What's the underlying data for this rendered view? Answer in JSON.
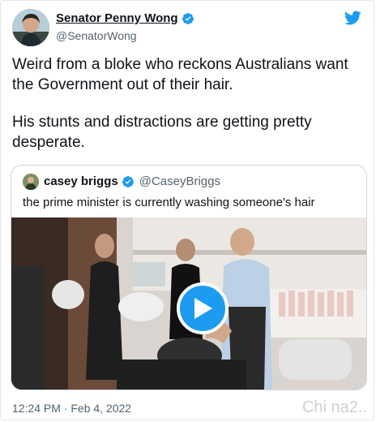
{
  "author": {
    "name": "Senator Penny Wong",
    "handle": "@SenatorWong"
  },
  "tweet": {
    "paragraphs": [
      "Weird from a bloke who reckons Australians want the Government out of their hair.",
      "His stunts and distractions are getting pretty desperate."
    ]
  },
  "quoted": {
    "name": "casey briggs",
    "handle": "@CaseyBriggs",
    "text": "the prime minister is currently washing someone's hair"
  },
  "media": {
    "type": "video",
    "play_icon": "play-icon"
  },
  "footer": {
    "timestamp": "12:24 PM · Feb 4, 2022"
  },
  "watermark": "Chi na2..",
  "icons": {
    "brand": "twitter-bird-icon",
    "verified": "verified-badge-icon"
  },
  "colors": {
    "twitter_blue": "#1d9bf0",
    "text": "#0f1419",
    "secondary": "#536471"
  }
}
